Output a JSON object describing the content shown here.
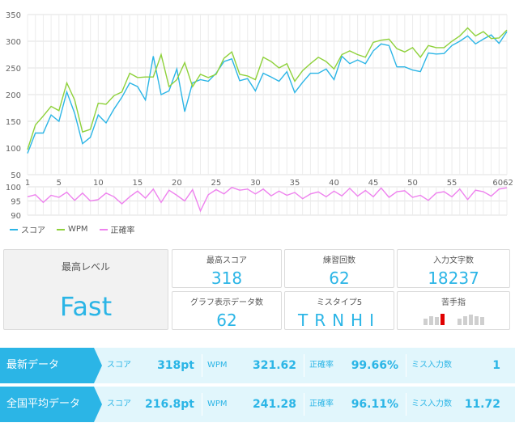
{
  "chart_data": [
    {
      "type": "line",
      "ylim": [
        50,
        350
      ],
      "yticks": [
        50,
        100,
        150,
        200,
        250,
        300,
        350
      ],
      "xticks": [
        "1",
        "5",
        "10",
        "15",
        "20",
        "25",
        "30",
        "35",
        "40",
        "45",
        "50",
        "55",
        "6062"
      ],
      "grid": true,
      "x": [
        1,
        2,
        3,
        4,
        5,
        6,
        7,
        8,
        9,
        10,
        11,
        12,
        13,
        14,
        15,
        16,
        17,
        18,
        19,
        20,
        21,
        22,
        23,
        24,
        25,
        26,
        27,
        28,
        29,
        30,
        31,
        32,
        33,
        34,
        35,
        36,
        37,
        38,
        39,
        40,
        41,
        42,
        43,
        44,
        45,
        46,
        47,
        48,
        49,
        50,
        51,
        52,
        53,
        54,
        55,
        56,
        57,
        58,
        59,
        60,
        61,
        62
      ],
      "series": [
        {
          "name": "スコア",
          "color": "#2bb5e6",
          "values": [
            90,
            128,
            128,
            162,
            150,
            205,
            165,
            108,
            120,
            162,
            147,
            173,
            195,
            222,
            215,
            190,
            272,
            200,
            207,
            248,
            168,
            222,
            228,
            225,
            240,
            262,
            267,
            226,
            230,
            207,
            240,
            233,
            225,
            243,
            204,
            223,
            240,
            240,
            248,
            228,
            272,
            258,
            265,
            258,
            282,
            295,
            292,
            252,
            252,
            246,
            243,
            278,
            276,
            277,
            292,
            300,
            310,
            295,
            304,
            312,
            296,
            318
          ]
        },
        {
          "name": "WPM",
          "color": "#8ed13a",
          "values": [
            97,
            143,
            160,
            178,
            170,
            222,
            190,
            130,
            135,
            184,
            182,
            198,
            205,
            240,
            232,
            233,
            233,
            275,
            215,
            228,
            260,
            215,
            238,
            232,
            238,
            268,
            280,
            238,
            235,
            228,
            270,
            262,
            250,
            258,
            225,
            245,
            258,
            270,
            262,
            248,
            275,
            282,
            275,
            270,
            298,
            302,
            304,
            286,
            280,
            288,
            270,
            292,
            288,
            288,
            300,
            310,
            325,
            310,
            318,
            305,
            306,
            321
          ]
        }
      ]
    },
    {
      "type": "line",
      "ylim": [
        90,
        100
      ],
      "yticks": [
        90,
        95,
        100
      ],
      "x": [
        1,
        2,
        3,
        4,
        5,
        6,
        7,
        8,
        9,
        10,
        11,
        12,
        13,
        14,
        15,
        16,
        17,
        18,
        19,
        20,
        21,
        22,
        23,
        24,
        25,
        26,
        27,
        28,
        29,
        30,
        31,
        32,
        33,
        34,
        35,
        36,
        37,
        38,
        39,
        40,
        41,
        42,
        43,
        44,
        45,
        46,
        47,
        48,
        49,
        50,
        51,
        52,
        53,
        54,
        55,
        56,
        57,
        58,
        59,
        60,
        61,
        62
      ],
      "series": [
        {
          "name": "正確率",
          "color": "#ee82ee",
          "values": [
            96.5,
            97.2,
            94.5,
            97,
            96.3,
            98.1,
            95.2,
            97.8,
            95,
            95.5,
            97.8,
            96.5,
            94,
            96.5,
            98.5,
            96,
            99.2,
            94.5,
            98.8,
            97,
            95,
            99,
            91.5,
            97.2,
            99,
            97.5,
            99.8,
            98.8,
            99.2,
            97.5,
            99.2,
            96.8,
            98.5,
            97,
            98,
            95.8,
            97.5,
            98.2,
            96.5,
            98.5,
            96.8,
            99.5,
            96.7,
            98.7,
            96.5,
            99.6,
            96.3,
            98.3,
            98.6,
            96.3,
            97,
            95.2,
            97.8,
            98.3,
            96.5,
            99.2,
            95.5,
            98.8,
            98.3,
            96.7,
            99.2,
            99.66
          ]
        }
      ]
    }
  ],
  "legend": [
    {
      "label": "スコア",
      "color": "#2bb5e6"
    },
    {
      "label": "WPM",
      "color": "#8ed13a"
    },
    {
      "label": "正確率",
      "color": "#ee82ee"
    }
  ],
  "summary": {
    "level_label": "最高レベル",
    "level_value": "Fast",
    "best_score_label": "最高スコア",
    "best_score_value": "318",
    "practice_count_label": "練習回数",
    "practice_count_value": "62",
    "chars_typed_label": "入力文字数",
    "chars_typed_value": "18237",
    "graph_points_label": "グラフ表示データ数",
    "graph_points_value": "62",
    "miss_type_label": "ミスタイプ5",
    "miss_type_value": "TRNHI",
    "weak_finger_label": "苦手指",
    "weak_finger_levels": [
      0.5,
      0.7,
      0.6,
      0.9,
      0.5,
      0.7,
      0.8,
      0.7,
      0.6
    ],
    "weak_finger_index": 3,
    "weak_finger_color": "#e00000"
  },
  "rows": [
    {
      "head": "最新データ",
      "score_label": "スコア",
      "score_value": "318pt",
      "wpm_label": "WPM",
      "wpm_value": "321.62",
      "accuracy_label": "正確率",
      "accuracy_value": "99.66%",
      "miss_label": "ミス入力数",
      "miss_value": "1"
    },
    {
      "head": "全国平均データ",
      "score_label": "スコア",
      "score_value": "216.8pt",
      "wpm_label": "WPM",
      "wpm_value": "241.28",
      "accuracy_label": "正確率",
      "accuracy_value": "96.11%",
      "miss_label": "ミス入力数",
      "miss_value": "11.72"
    }
  ]
}
